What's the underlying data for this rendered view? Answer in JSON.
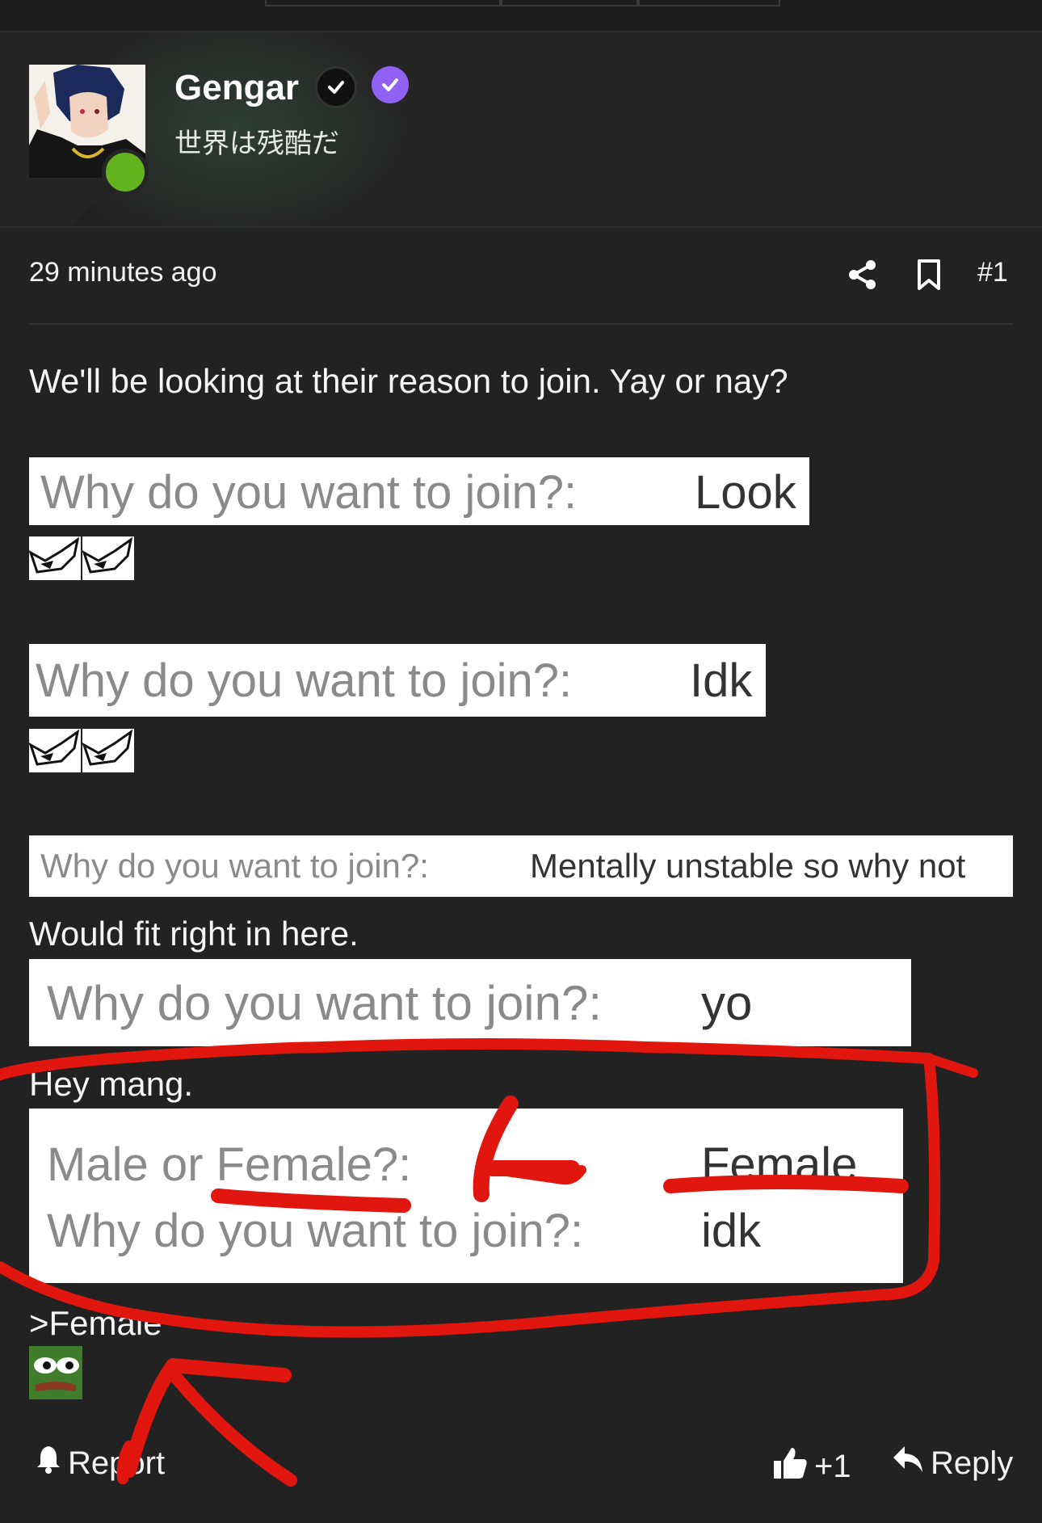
{
  "header": {
    "username": "Gengar",
    "tagline": "世界は残酷だ"
  },
  "post": {
    "timestamp": "29 minutes ago",
    "post_number": "#1",
    "intro": "We'll be looking at their reason to join. Yay or nay?",
    "cards": [
      {
        "question": "Why do you want to join?:",
        "answer": "Look"
      },
      {
        "question": "Why do you want to join?:",
        "answer": "Idk"
      },
      {
        "question": "Why do you want to join?:",
        "answer": "Mentally unstable so why not"
      },
      {
        "question": "Why do you want to join?:",
        "answer": "yo"
      },
      {
        "question1": "Male or Female?:",
        "answer1": "Female",
        "question2": "Why do you want to join?:",
        "answer2": "idk"
      }
    ],
    "comment_fit": "Would fit right in here.",
    "comment_hey": "Hey mang.",
    "comment_female": ">Female"
  },
  "footer": {
    "report_label": "Report",
    "like_count": "+1",
    "reply_label": "Reply"
  },
  "colors": {
    "background": "#222222",
    "online": "#63b31f",
    "verified": "#8f62f5",
    "annotation": "#e0160f"
  }
}
